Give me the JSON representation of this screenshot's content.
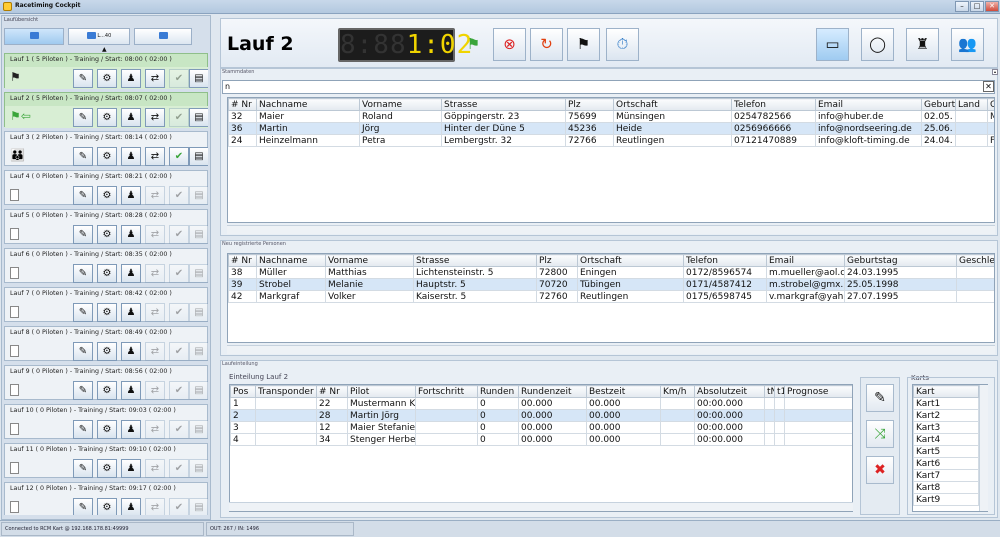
{
  "window": {
    "title": "Racetiming Cockpit",
    "min": "–",
    "max": "□",
    "close": "✕"
  },
  "left": {
    "caption": "Laufübersicht",
    "nav_mid": "L...40",
    "runs": [
      {
        "title": "Lauf 1  ( 5 Piloten )  - Training / Start: 08:00 ( 02:00 )",
        "icon": "⚑",
        "active": true
      },
      {
        "title": "Lauf 2  ( 5 Piloten )  - Training / Start: 08:07 ( 02:00 )",
        "icon": "⚑⇦",
        "active": true
      },
      {
        "title": "Lauf 3  ( 2 Piloten )  - Training / Start: 08:14 ( 02:00 )",
        "icon": "👪",
        "active": false
      },
      {
        "title": "Lauf 4  ( 0 Piloten )  - Training / Start: 08:21 ( 02:00 )",
        "icon": "",
        "active": false
      },
      {
        "title": "Lauf 5  ( 0 Piloten )  - Training / Start: 08:28 ( 02:00 )",
        "icon": "",
        "active": false
      },
      {
        "title": "Lauf 6  ( 0 Piloten )  - Training / Start: 08:35 ( 02:00 )",
        "icon": "",
        "active": false
      },
      {
        "title": "Lauf 7  ( 0 Piloten )  - Training / Start: 08:42 ( 02:00 )",
        "icon": "",
        "active": false
      },
      {
        "title": "Lauf 8  ( 0 Piloten )  - Training / Start: 08:49 ( 02:00 )",
        "icon": "",
        "active": false
      },
      {
        "title": "Lauf 9  ( 0 Piloten )  - Training / Start: 08:56 ( 02:00 )",
        "icon": "",
        "active": false
      },
      {
        "title": "Lauf 10  ( 0 Piloten )  - Training / Start: 09:03 ( 02:00 )",
        "icon": "",
        "active": false
      },
      {
        "title": "Lauf 11  ( 0 Piloten )  - Training / Start: 09:10 ( 02:00 )",
        "icon": "",
        "active": false
      },
      {
        "title": "Lauf 12  ( 0 Piloten )  - Training / Start: 09:17 ( 02:00 )",
        "icon": "",
        "active": false
      }
    ]
  },
  "header": {
    "title": "Lauf 2",
    "clock_dim": "8:88",
    "clock": "1:02"
  },
  "stamm": {
    "caption": "Stammdaten",
    "search": "n",
    "columns": [
      "# Nr",
      "Nachname",
      "Vorname",
      "Strasse",
      "Plz",
      "Ortschaft",
      "Telefon",
      "Email",
      "Geburt",
      "Land",
      "G"
    ],
    "rows": [
      [
        "32",
        "Maier",
        "Roland",
        "Göppingerstr. 23",
        "75699",
        "Münsingen",
        "0254782566",
        "info@huber.de",
        "02.05.",
        "",
        "M"
      ],
      [
        "36",
        "Martin",
        "Jörg",
        "Hinter der Düne 5",
        "45236",
        "Heide",
        "0256966666",
        "info@nordseering.de",
        "25.06.",
        "",
        ""
      ],
      [
        "24",
        "Heinzelmann",
        "Petra",
        "Lembergstr. 32",
        "72766",
        "Reutlingen",
        "07121470889",
        "info@kloft-timing.de",
        "24.04.",
        "",
        "F"
      ]
    ]
  },
  "neu": {
    "caption": "Neu registrierte Personen",
    "columns": [
      "# Nr",
      "Nachname",
      "Vorname",
      "Strasse",
      "Plz",
      "Ortschaft",
      "Telefon",
      "Email",
      "Geburtstag",
      "Geschlec"
    ],
    "rows": [
      [
        "38",
        "Müller",
        "Matthias",
        "Lichtensteinstr. 5",
        "72800",
        "Eningen",
        "0172/8596574",
        "m.mueller@aol.c",
        "24.03.1995",
        ""
      ],
      [
        "39",
        "Strobel",
        "Melanie",
        "Hauptstr. 5",
        "70720",
        "Tübingen",
        "0171/4587412",
        "m.strobel@gmx.",
        "25.05.1998",
        ""
      ],
      [
        "42",
        "Markgraf",
        "Volker",
        "Kaiserstr. 5",
        "72760",
        "Reutlingen",
        "0175/6598745",
        "v.markgraf@yah",
        "27.07.1995",
        ""
      ]
    ]
  },
  "einteilung": {
    "caption": "Laufeinteilung",
    "group": "Einteilung Lauf 2",
    "columns": [
      "Pos",
      "Transponder",
      "# Nr",
      "Pilot",
      "Fortschritt",
      "Runden",
      "Rundenzeit",
      "Bestzeit",
      "Km/h",
      "Absolutzeit",
      "tN",
      "t1",
      "Prognose"
    ],
    "rows": [
      [
        "1",
        "",
        "22",
        "Mustermann K",
        "",
        "0",
        "00.000",
        "00.000",
        "",
        "00:00.000",
        "",
        "",
        ""
      ],
      [
        "2",
        "",
        "28",
        "Martin Jörg",
        "",
        "0",
        "00.000",
        "00.000",
        "",
        "00:00.000",
        "",
        "",
        ""
      ],
      [
        "3",
        "",
        "12",
        "Maier Stefanie",
        "",
        "0",
        "00.000",
        "00.000",
        "",
        "00:00.000",
        "",
        "",
        ""
      ],
      [
        "4",
        "",
        "34",
        "Stenger Herbe",
        "",
        "0",
        "00.000",
        "00.000",
        "",
        "00:00.000",
        "",
        "",
        ""
      ]
    ]
  },
  "karts": {
    "caption": "Karts",
    "header": "Kart",
    "items": [
      "Kart1",
      "Kart2",
      "Kart3",
      "Kart4",
      "Kart5",
      "Kart6",
      "Kart7",
      "Kart8",
      "Kart9"
    ]
  },
  "status": {
    "left": "Connected to RCM Kart @ 192.168.178.81:49999",
    "right": "OUT: 267 / IN: 1496"
  },
  "colors": {
    "active_run": "#c8e6c4",
    "lcd_digits": "#f0d400",
    "selected_row": "#d6e6f7"
  }
}
